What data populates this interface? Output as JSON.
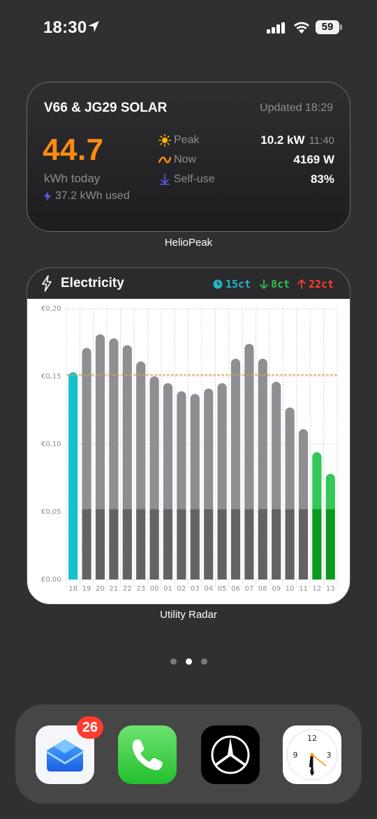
{
  "status_bar": {
    "time": "18:30",
    "battery": "59",
    "icons": [
      "location-arrow-icon",
      "cellular-signal-icon",
      "wifi-icon",
      "battery-icon"
    ]
  },
  "solar_widget": {
    "title": "V66 & JG29 SOLAR",
    "updated": "Updated 18:29",
    "big_value": "44.7",
    "big_unit": "kWh today",
    "used": "37.2 kWh used",
    "stats": [
      {
        "icon": "sun-icon",
        "label": "Peak",
        "value": "10.2 kW",
        "sub": "11:40"
      },
      {
        "icon": "wave-icon",
        "label": "Now",
        "value": "4169 W",
        "sub": ""
      },
      {
        "icon": "arrow-down-icon",
        "label": "Self-use",
        "value": "83%",
        "sub": ""
      }
    ],
    "caption": "HelioPeak",
    "accent_color": "#ff8a10"
  },
  "electricity_widget": {
    "title": "Electricity",
    "prices": [
      {
        "icon": "clock-icon",
        "text": "15ct",
        "color": "#22b8c8"
      },
      {
        "icon": "arrow-down-icon",
        "text": "8ct",
        "color": "#30c048"
      },
      {
        "icon": "arrow-up-icon",
        "text": "22ct",
        "color": "#ff3b30"
      }
    ],
    "caption": "Utility Radar"
  },
  "chart_data": {
    "type": "bar",
    "categories": [
      "18",
      "19",
      "20",
      "21",
      "22",
      "23",
      "00",
      "01",
      "02",
      "03",
      "04",
      "05",
      "06",
      "07",
      "08",
      "09",
      "10",
      "11",
      "12",
      "13"
    ],
    "values": [
      0.153,
      0.171,
      0.181,
      0.178,
      0.173,
      0.161,
      0.15,
      0.145,
      0.139,
      0.137,
      0.141,
      0.145,
      0.163,
      0.174,
      0.163,
      0.146,
      0.127,
      0.111,
      0.094,
      0.078
    ],
    "base_component": 0.052,
    "reference_line": 0.151,
    "ylim": [
      0,
      0.2
    ],
    "yticks": [
      "€0,00",
      "€0,05",
      "€0,10",
      "€0,15",
      "€0,20"
    ],
    "ytick_values": [
      0,
      0.05,
      0.1,
      0.15,
      0.2
    ],
    "current_index": 0,
    "cheap_indices": [
      18,
      19
    ],
    "colors": {
      "current": "#18c0cc",
      "normal_top": "#8e8e93",
      "normal_base": "#636366",
      "cheap_top": "#34c759",
      "cheap_base": "#0a9a1f",
      "reference": "#e0a050"
    }
  },
  "pager": {
    "count": 3,
    "active": 1
  },
  "dock": {
    "apps": [
      {
        "name": "mail-app-icon",
        "badge": "26"
      },
      {
        "name": "phone-app-icon",
        "badge": ""
      },
      {
        "name": "mercedes-app-icon",
        "badge": ""
      },
      {
        "name": "clock-app-icon",
        "badge": ""
      }
    ],
    "clock_numbers": [
      "12",
      "3",
      "6",
      "9"
    ]
  }
}
